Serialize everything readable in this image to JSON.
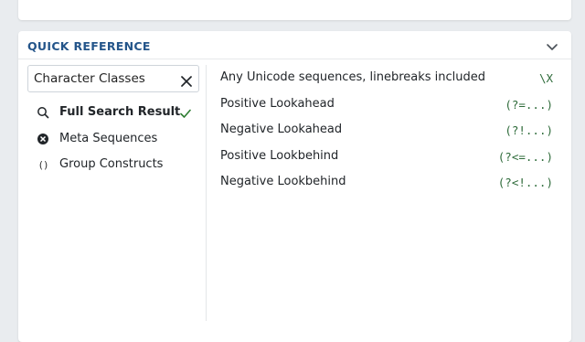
{
  "panel": {
    "title": "QUICK REFERENCE"
  },
  "search": {
    "value": "Character Classes"
  },
  "categories": [
    {
      "label": "Full Search Result",
      "icon": "search-icon",
      "active": true
    },
    {
      "label": "Meta Sequences",
      "icon": "meta-sequence-icon",
      "active": false
    },
    {
      "label": "Group Constructs",
      "icon": "parentheses-icon",
      "active": false
    }
  ],
  "group_icon_glyph": "()",
  "references": [
    {
      "description": "Any Unicode sequences, linebreaks included",
      "token": "\\X"
    },
    {
      "description": "Positive Lookahead",
      "token": "(?=...)"
    },
    {
      "description": "Negative Lookahead",
      "token": "(?!...)"
    },
    {
      "description": "Positive Lookbehind",
      "token": "(?<=...)"
    },
    {
      "description": "Negative Lookbehind",
      "token": "(?<!...)"
    }
  ],
  "colors": {
    "title": "#24558a",
    "token": "#2e6b3a",
    "check": "#2e7d32",
    "background": "#e9ecef"
  }
}
